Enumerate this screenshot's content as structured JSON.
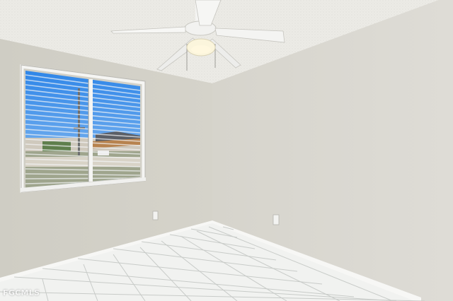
{
  "photo": {
    "subject": "empty-room-interior",
    "watermark": "FGCMLS",
    "colors": {
      "ceiling": "#ecebe6",
      "wall_left": "#d3d1c8",
      "wall_right": "#d9d7d0",
      "floor_tile": "#f2f3f1",
      "grout": "#c9ccc9",
      "sky": "#3f8fe0",
      "blinds": "#e7e9ee"
    }
  }
}
